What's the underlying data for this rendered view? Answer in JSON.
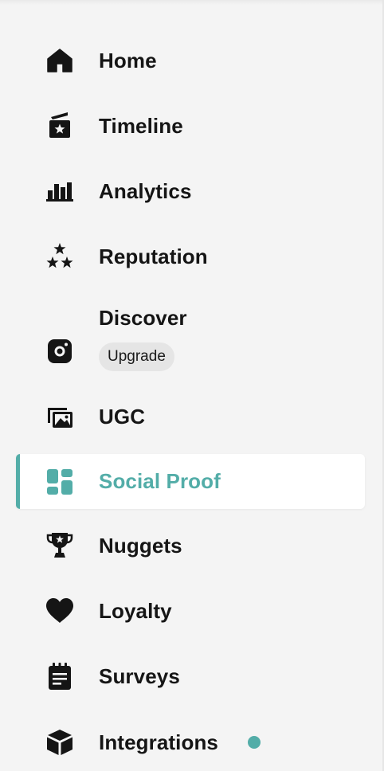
{
  "colors": {
    "accent": "#53ada8",
    "text": "#151515",
    "background": "#f4f4f4",
    "active_background": "#ffffff",
    "badge_background": "#e5e5e5",
    "notification_dot": "#53ada8"
  },
  "nav": {
    "items": [
      {
        "label": "Home",
        "icon": "home-icon",
        "active": false
      },
      {
        "label": "Timeline",
        "icon": "timeline-icon",
        "active": false
      },
      {
        "label": "Analytics",
        "icon": "bar-chart-icon",
        "active": false
      },
      {
        "label": "Reputation",
        "icon": "stars-icon",
        "active": false
      },
      {
        "label": "Discover",
        "icon": "instagram-icon",
        "active": false,
        "badge": "Upgrade"
      },
      {
        "label": "UGC",
        "icon": "images-icon",
        "active": false
      },
      {
        "label": "Social Proof",
        "icon": "dashboard-icon",
        "active": true
      },
      {
        "label": "Nuggets",
        "icon": "trophy-icon",
        "active": false
      },
      {
        "label": "Loyalty",
        "icon": "heart-icon",
        "active": false
      },
      {
        "label": "Surveys",
        "icon": "notepad-icon",
        "active": false
      },
      {
        "label": "Integrations",
        "icon": "cube-icon",
        "active": false,
        "has_notification_dot": true
      }
    ]
  }
}
